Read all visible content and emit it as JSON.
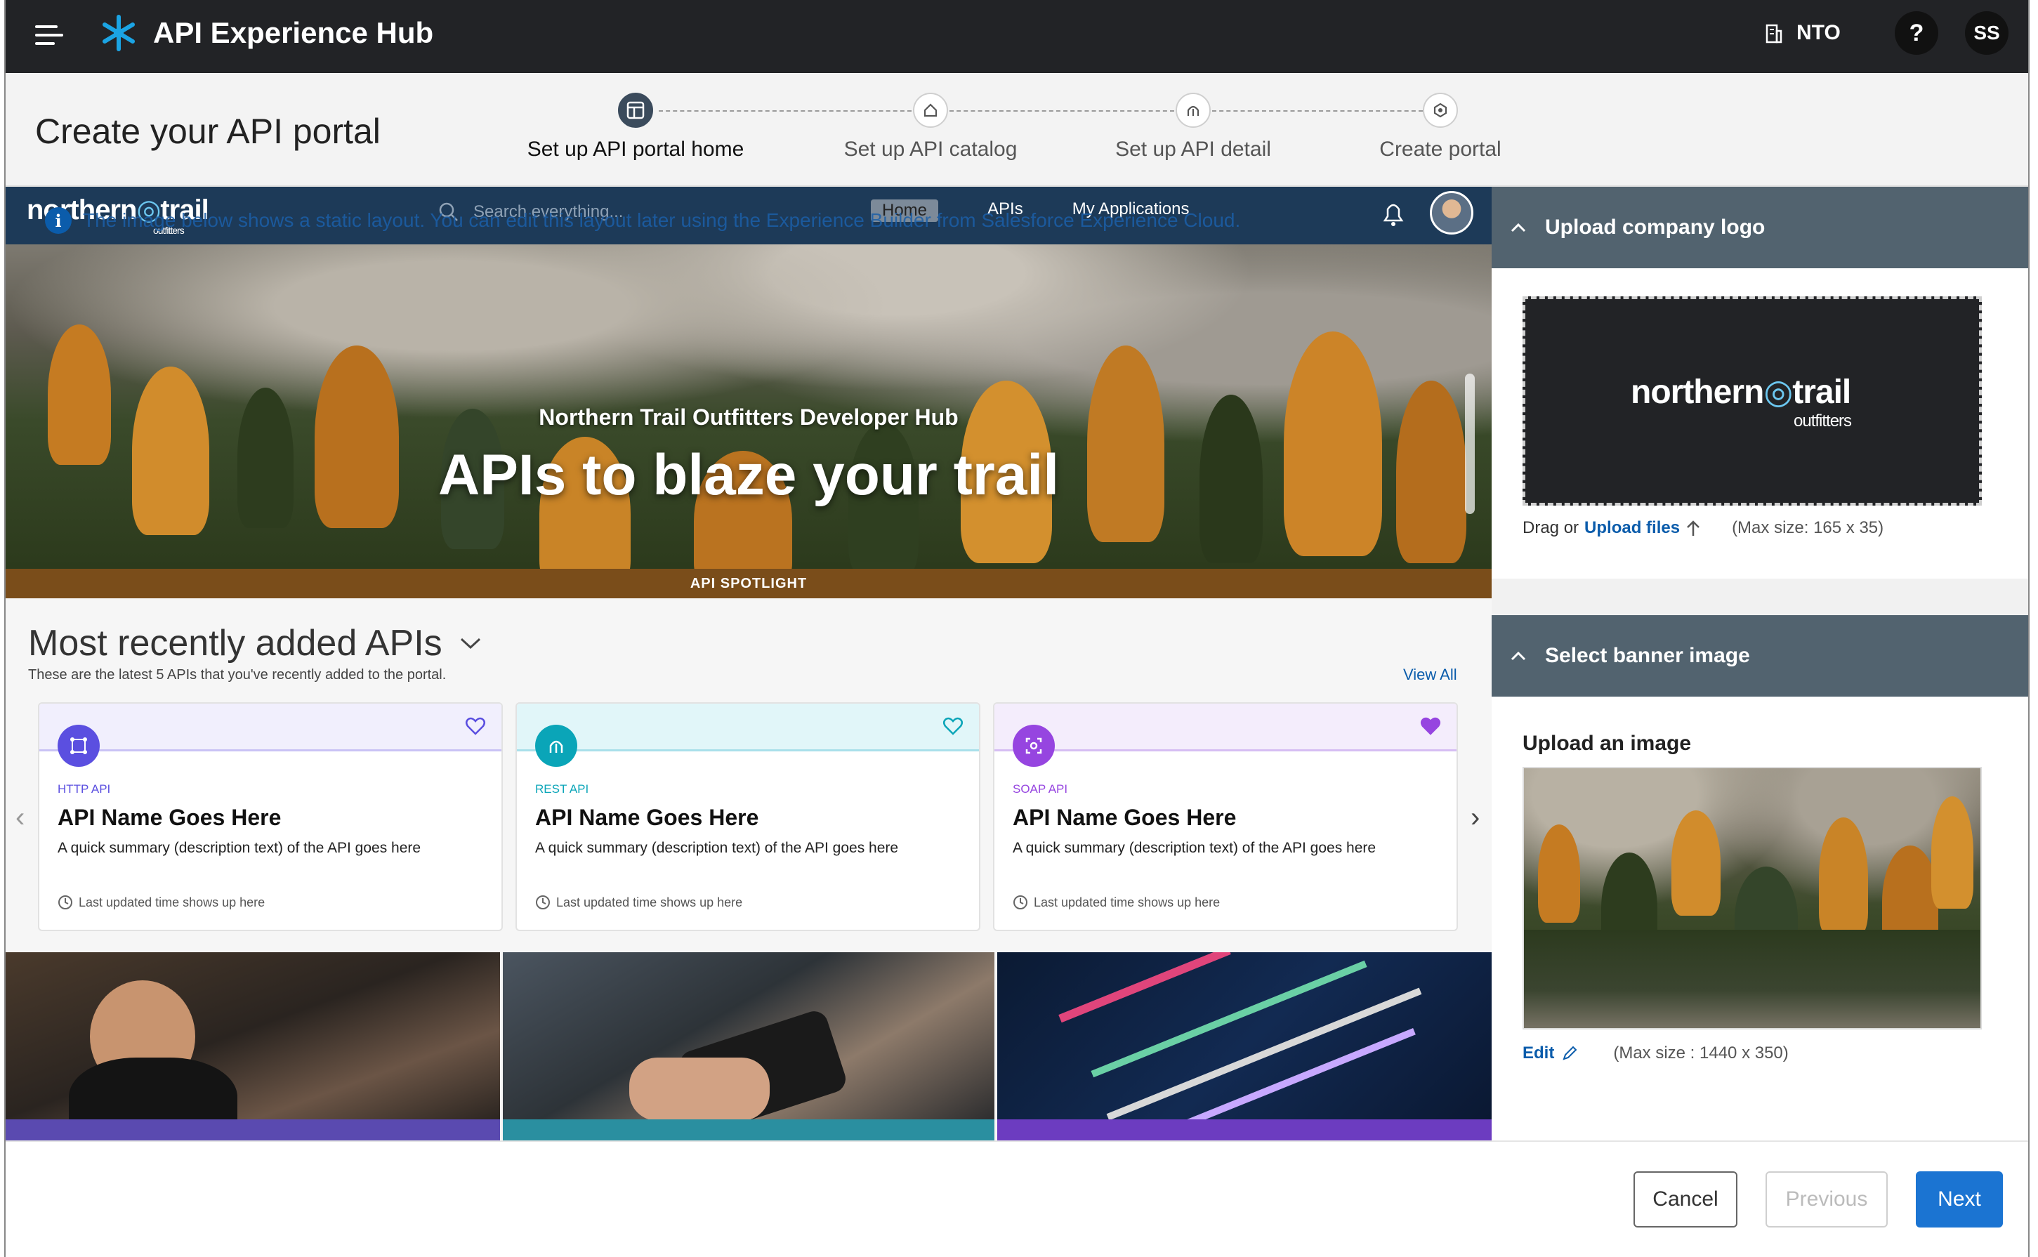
{
  "app": {
    "title": "API Experience Hub",
    "org_label": "NTO",
    "help_label": "?",
    "user_initials": "SS"
  },
  "wizard": {
    "title": "Create your API portal",
    "steps": [
      {
        "label": "Set up API portal home",
        "active": true
      },
      {
        "label": "Set up API catalog",
        "active": false
      },
      {
        "label": "Set up API detail",
        "active": false
      },
      {
        "label": "Create portal",
        "active": false
      }
    ]
  },
  "preview": {
    "brand": "northern",
    "brand_trail": "trail",
    "brand_sub": "outfitters",
    "search_placeholder": "Search everything...",
    "nav": [
      "Home",
      "APIs",
      "My Applications"
    ],
    "info_text": "The image below shows a static layout. You can edit this layout later using the Experience Builder from Salesforce Experience Cloud.",
    "hero_subtitle": "Northern Trail Outfitters Developer Hub",
    "hero_title": "APIs to blaze your trail",
    "spotlight": "API SPOTLIGHT",
    "recent_title": "Most recently added APIs",
    "recent_sub": "These are the latest 5 APIs that you've recently added to the portal.",
    "view_all": "View All",
    "cards": [
      {
        "kind": "HTTP API",
        "name": "API Name Goes Here",
        "desc": "A quick summary (description text) of the API goes here",
        "updated": "Last updated time shows up here",
        "favorited": false,
        "color": "#5b4fe0",
        "band": "#f1effd"
      },
      {
        "kind": "REST API",
        "name": "API Name Goes Here",
        "desc": "A quick summary (description text) of the API goes here",
        "updated": "Last updated time shows up here",
        "favorited": false,
        "color": "#0aa5b8",
        "band": "#e1f6f9"
      },
      {
        "kind": "SOAP API",
        "name": "API Name Goes Here",
        "desc": "A quick summary (description text) of the API goes here",
        "updated": "Last updated time shows up here",
        "favorited": true,
        "color": "#9645e0",
        "band": "#f4edfc"
      }
    ]
  },
  "panel": {
    "logo_section": {
      "title": "Upload company logo",
      "drag": "Drag or",
      "upload": "Upload files",
      "max": "(Max size: 165 x 35)"
    },
    "banner_section": {
      "title": "Select banner image",
      "upload_heading": "Upload an image",
      "edit": "Edit",
      "max": "(Max size : 1440 x 350)"
    }
  },
  "footer": {
    "cancel": "Cancel",
    "previous": "Previous",
    "next": "Next"
  },
  "colors": {
    "topbar": "#222326",
    "accent": "#1b74d2",
    "panel_header": "#52636f",
    "link": "#0b5cab"
  }
}
